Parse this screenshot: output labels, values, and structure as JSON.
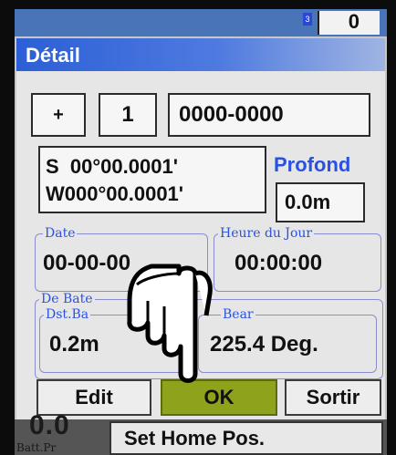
{
  "status": {
    "indicator": "3",
    "counter": "0"
  },
  "dialog": {
    "title": "Détail",
    "sign": "+",
    "index": "1",
    "code": "0000-0000",
    "lat": "S  00°00.0001'",
    "lon": "W000°00.0001'",
    "depth_label": "Profond",
    "depth_value": "0.0m",
    "date_label": "Date",
    "date_value": "00-00-00",
    "time_label": "Heure du Jour",
    "time_value": "00:00:00",
    "from_boat_label": "De Bate",
    "dist_label": "Dst.Ba",
    "dist_value": "0.2m",
    "bear_label": "Bear",
    "bear_value": "225.4 Deg."
  },
  "buttons": {
    "edit": "Edit",
    "ok": "OK",
    "exit": "Sortir"
  },
  "background": {
    "digits": "0.0",
    "batt_label": "Batt.Pr",
    "home_button": "Set Home Pos."
  },
  "colors": {
    "title_bar": "#2c5fd6",
    "ok_button": "#8fa21c",
    "group_label": "#2a52e0"
  }
}
